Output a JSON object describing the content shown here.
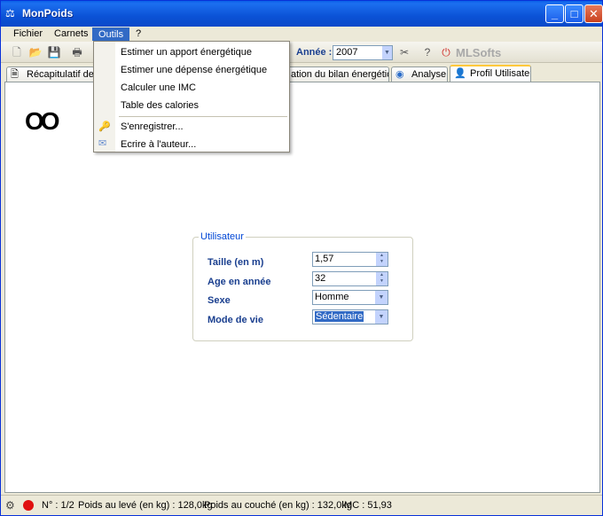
{
  "window": {
    "title": "MonPoids",
    "minimize": "_",
    "maximize": "□",
    "close": "✕"
  },
  "menubar": {
    "items": [
      "Fichier",
      "Carnets",
      "Outils",
      "?"
    ]
  },
  "toolbar": {
    "annee_label": "Année :",
    "annee_value": "2007",
    "brand": "MLSofts"
  },
  "tabs": [
    {
      "label": "Récapitulatif des",
      "icon": "document-icon"
    },
    {
      "label": "ation du bilan énergétique",
      "icon": "none"
    },
    {
      "label": "Analyse",
      "icon": "globe-icon"
    },
    {
      "label": "Profil Utilisateur",
      "icon": "user-icon"
    }
  ],
  "outils_menu": {
    "items": [
      "Estimer un apport énergétique",
      "Estimer une dépense énergétique",
      "Calculer une IMC",
      "Table des calories",
      "S'enregistrer...",
      "Ecrire à l'auteur..."
    ]
  },
  "panel": {
    "eyes": "OO"
  },
  "user_form": {
    "legend": "Utilisateur",
    "taille_label": "Taille (en m)",
    "taille_value": "1,57",
    "age_label": "Age en année",
    "age_value": "32",
    "sexe_label": "Sexe",
    "sexe_value": "Homme",
    "mode_label": "Mode de vie",
    "mode_value": "Sédentaire"
  },
  "statusbar": {
    "num": "N° : 1/2",
    "poids_leve": "Poids au levé (en kg) : 128,0kg",
    "poids_couche": "Poids au couché (en kg) : 132,0kg",
    "imc": "IMC : 51,93"
  },
  "colors": {
    "titlebar": "#0A5FE8",
    "menu_highlight": "#316AC5",
    "label_blue": "#1A3F8F",
    "status_red": "#E01010"
  }
}
